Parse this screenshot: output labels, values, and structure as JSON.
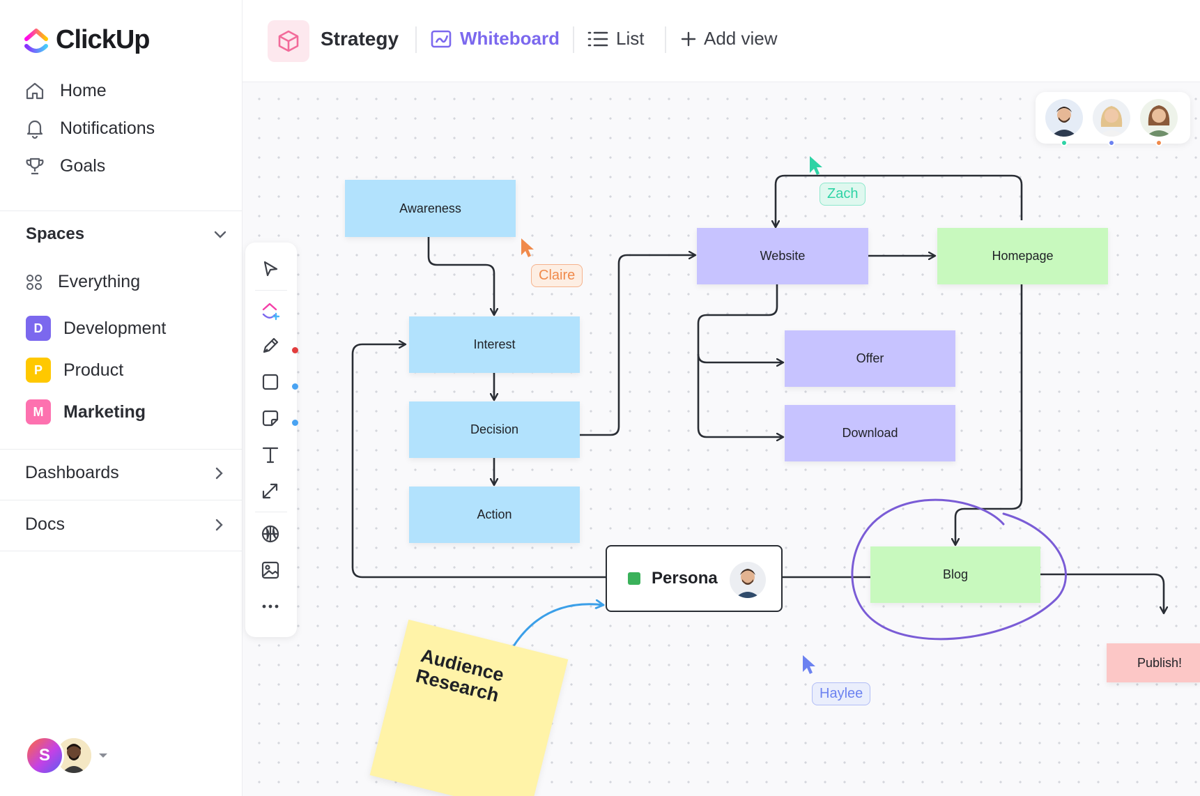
{
  "app": {
    "name": "ClickUp"
  },
  "sidebar": {
    "nav": [
      {
        "label": "Home",
        "icon": "home-icon"
      },
      {
        "label": "Notifications",
        "icon": "bell-icon"
      },
      {
        "label": "Goals",
        "icon": "trophy-icon"
      }
    ],
    "spaces_title": "Spaces",
    "spaces": [
      {
        "label": "Everything",
        "icon": "grid-icon"
      },
      {
        "label": "Development",
        "badge": "D",
        "color": "#7b68ee"
      },
      {
        "label": "Product",
        "badge": "P",
        "color": "#ffc800"
      },
      {
        "label": "Marketing",
        "badge": "M",
        "color": "#fd71af",
        "active": true
      }
    ],
    "dashboards": "Dashboards",
    "docs": "Docs",
    "user_initial": "S"
  },
  "header": {
    "title": "Strategy",
    "tabs": [
      {
        "label": "Whiteboard",
        "active": true
      },
      {
        "label": "List"
      },
      {
        "label": "Add view"
      }
    ]
  },
  "whiteboard": {
    "nodes": {
      "awareness": "Awareness",
      "interest": "Interest",
      "decision": "Decision",
      "action": "Action",
      "website": "Website",
      "homepage": "Homepage",
      "offer": "Offer",
      "download": "Download",
      "blog": "Blog",
      "publish": "Publish!"
    },
    "persona": "Persona",
    "sticky_line1": "Audience",
    "sticky_line2": "Research",
    "cursors": {
      "claire": {
        "name": "Claire",
        "color": "#f08a4b"
      },
      "zach": {
        "name": "Zach",
        "color": "#2ed3a5"
      },
      "haylee": {
        "name": "Haylee",
        "color": "#6c82f0"
      }
    }
  },
  "colors": {
    "accent": "#7b68ee",
    "arrow": "#292d34",
    "blue_arrow": "#3b9fe8",
    "lasso": "#7a5cd6"
  }
}
